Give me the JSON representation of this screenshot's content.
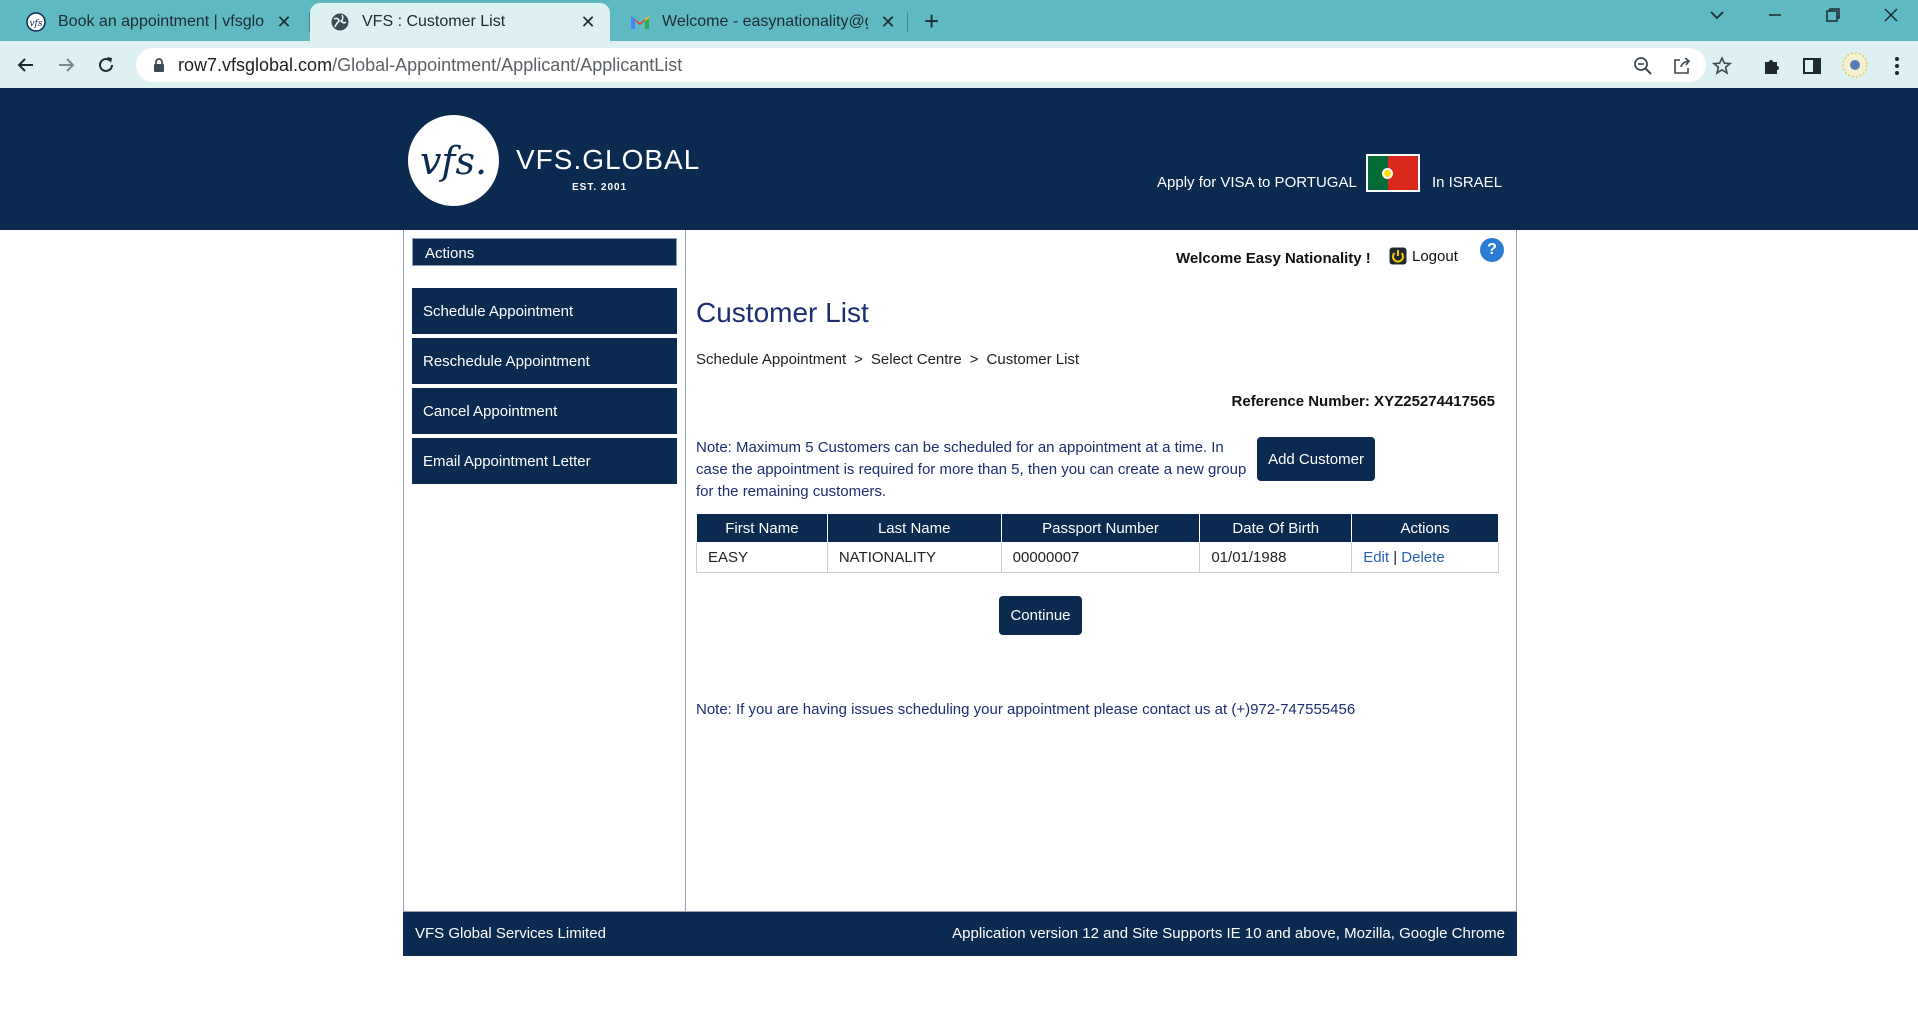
{
  "browser": {
    "tabs": [
      {
        "title": "Book an appointment | vfsglobal",
        "icon": "vfs-favicon-icon"
      },
      {
        "title": "VFS : Customer List",
        "icon": "globe-icon"
      },
      {
        "title": "Welcome - easynationality@gma",
        "icon": "gmail-icon"
      }
    ],
    "url_host": "row7.vfsglobal.com",
    "url_path": "/Global-Appointment/Applicant/ApplicantList"
  },
  "header": {
    "logo_mark": "vfs.",
    "logo_text": "VFS.GLOBAL",
    "logo_est": "EST. 2001",
    "apply_text": "Apply for VISA to PORTUGAL",
    "country_text": "In ISRAEL",
    "colors": {
      "navy": "#0b2a50",
      "flag_green": "#046a38",
      "flag_red": "#da291c"
    }
  },
  "sidebar": {
    "title": "Actions",
    "items": [
      {
        "label": "Schedule Appointment"
      },
      {
        "label": "Reschedule Appointment"
      },
      {
        "label": "Cancel Appointment"
      },
      {
        "label": "Email Appointment Letter"
      }
    ]
  },
  "user": {
    "welcome": "Welcome Easy Nationality !",
    "logout_label": "Logout",
    "help_label": "?"
  },
  "main": {
    "title": "Customer List",
    "breadcrumb": [
      "Schedule Appointment",
      "Select Centre",
      "Customer List"
    ],
    "breadcrumb_sep": ">",
    "reference_label": "Reference Number: XYZ25274417565",
    "note_max": "Note: Maximum 5 Customers can be scheduled for an appointment at a time. In case the appointment is required for more than 5, then you can create a new group for the remaining customers.",
    "add_customer_label": "Add Customer",
    "table": {
      "headers": [
        "First Name",
        "Last Name",
        "Passport Number",
        "Date Of Birth",
        "Actions"
      ],
      "rows": [
        {
          "first_name": "EASY",
          "last_name": "NATIONALITY",
          "passport": "00000007",
          "dob": "01/01/1988",
          "edit": "Edit",
          "divider": "|",
          "delete": "Delete"
        }
      ]
    },
    "continue_label": "Continue",
    "note_contact": "Note: If you are having issues scheduling your appointment please contact us at (+)972-747555456"
  },
  "footer": {
    "left": "VFS Global Services Limited",
    "right": "Application version 12 and Site Supports IE 10 and above, Mozilla, Google Chrome"
  }
}
